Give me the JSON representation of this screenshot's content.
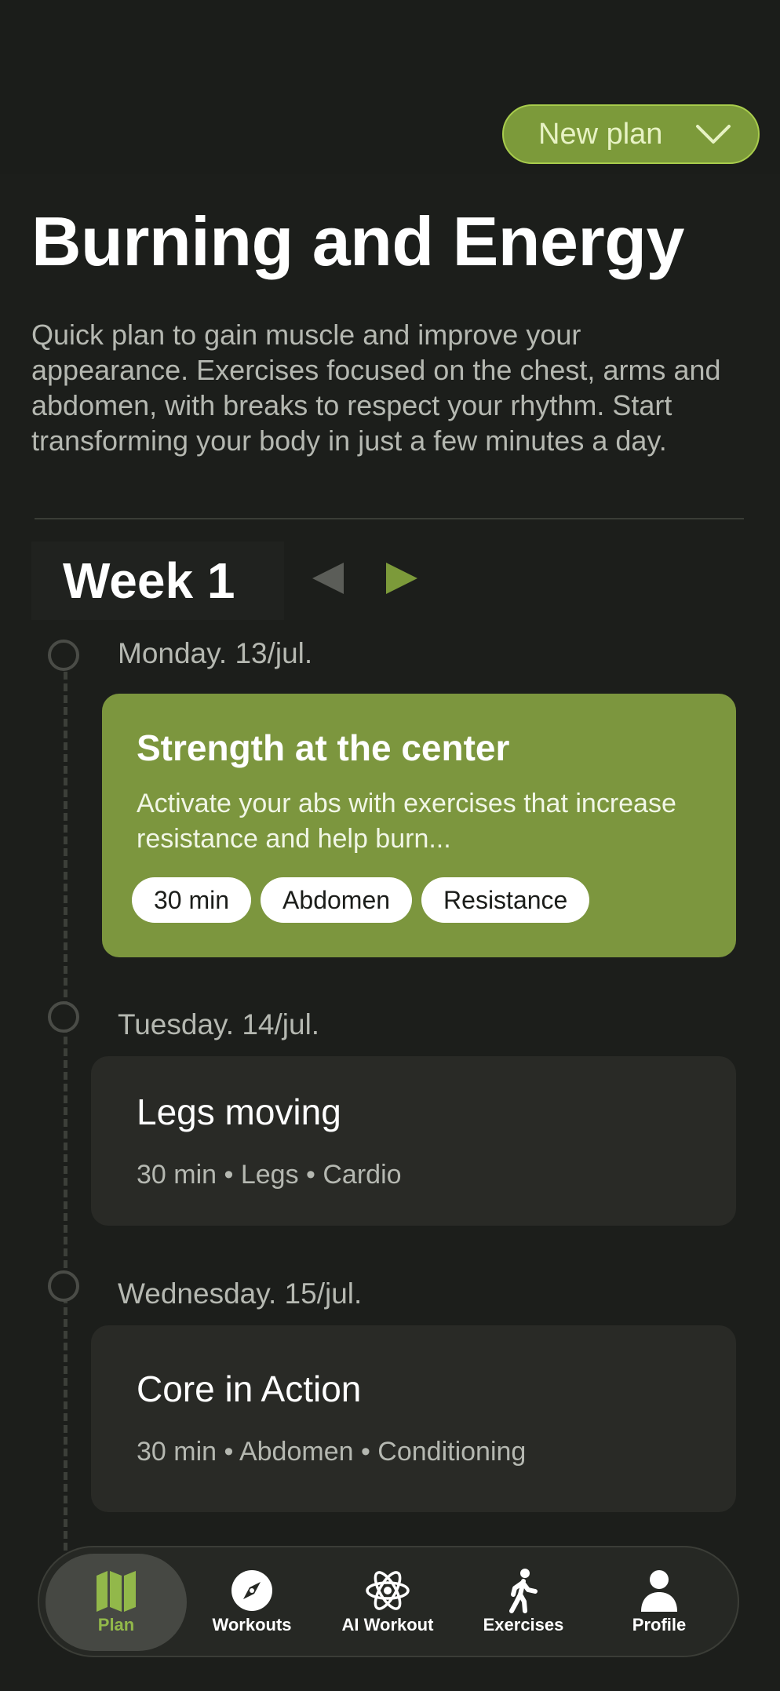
{
  "header": {
    "plan_button_label": "New plan"
  },
  "plan": {
    "title": "Burning and Energy",
    "description": "Quick plan to gain muscle and improve your appearance. Exercises focused on the chest, arms and abdomen, with breaks to respect your rhythm. Start transforming your body in just a few minutes a day."
  },
  "week": {
    "label": "Week 1"
  },
  "days": [
    {
      "date": "Monday. 13/jul.",
      "workout_title": "Strength at the center",
      "workout_description": "Activate your abs with exercises that increase resistance and help burn...",
      "tags": [
        "30 min",
        "Abdomen",
        "Resistance"
      ]
    },
    {
      "date": "Tuesday. 14/jul.",
      "workout_title": "Legs moving",
      "meta": "30 min • Legs • Cardio"
    },
    {
      "date": "Wednesday. 15/jul.",
      "workout_title": "Core in Action",
      "meta": "30 min • Abdomen • Conditioning"
    }
  ],
  "nav": {
    "items": [
      {
        "label": "Plan",
        "icon": "map-icon",
        "active": true
      },
      {
        "label": "Workouts",
        "icon": "compass-icon"
      },
      {
        "label": "AI Workout",
        "icon": "atom-icon"
      },
      {
        "label": "Exercises",
        "icon": "walking-person-icon"
      },
      {
        "label": "Profile",
        "icon": "person-icon"
      }
    ]
  },
  "colors": {
    "background": "#1c1e1b",
    "accent": "#7c963e",
    "accent_light": "#92b84a",
    "card": "#292a26"
  }
}
